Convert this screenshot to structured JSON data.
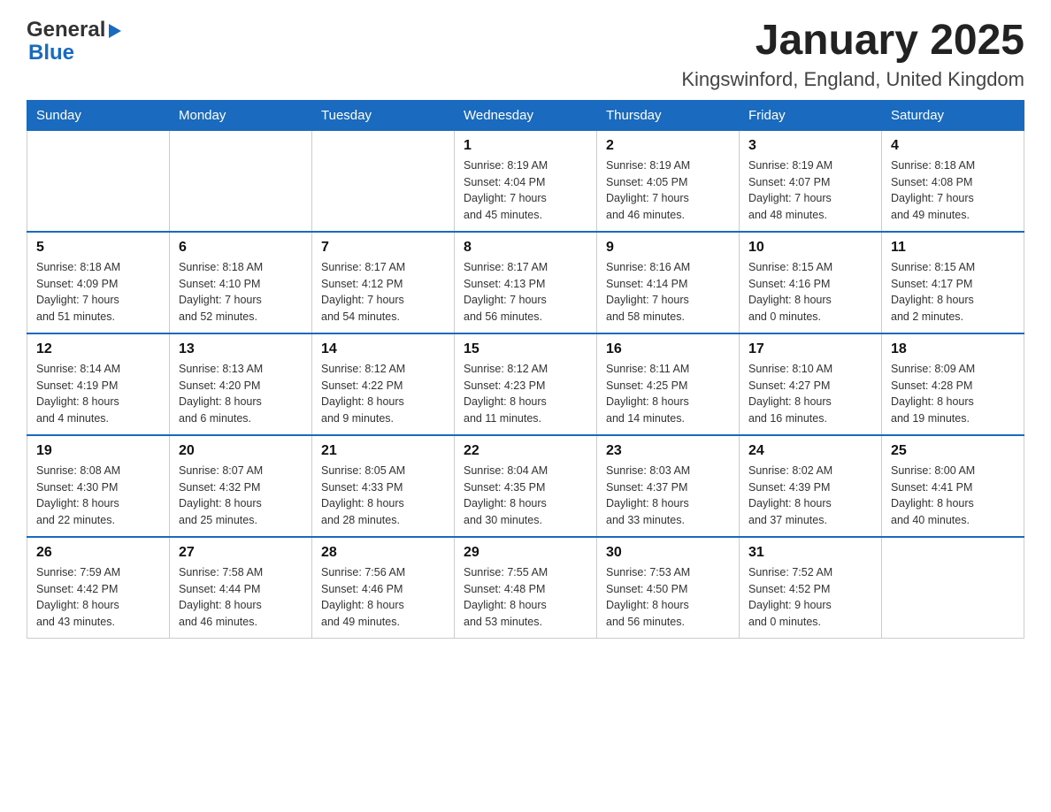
{
  "logo": {
    "general": "General",
    "blue": "Blue"
  },
  "header": {
    "month_year": "January 2025",
    "location": "Kingswinford, England, United Kingdom"
  },
  "weekdays": [
    "Sunday",
    "Monday",
    "Tuesday",
    "Wednesday",
    "Thursday",
    "Friday",
    "Saturday"
  ],
  "weeks": [
    [
      {
        "day": "",
        "info": ""
      },
      {
        "day": "",
        "info": ""
      },
      {
        "day": "",
        "info": ""
      },
      {
        "day": "1",
        "info": "Sunrise: 8:19 AM\nSunset: 4:04 PM\nDaylight: 7 hours\nand 45 minutes."
      },
      {
        "day": "2",
        "info": "Sunrise: 8:19 AM\nSunset: 4:05 PM\nDaylight: 7 hours\nand 46 minutes."
      },
      {
        "day": "3",
        "info": "Sunrise: 8:19 AM\nSunset: 4:07 PM\nDaylight: 7 hours\nand 48 minutes."
      },
      {
        "day": "4",
        "info": "Sunrise: 8:18 AM\nSunset: 4:08 PM\nDaylight: 7 hours\nand 49 minutes."
      }
    ],
    [
      {
        "day": "5",
        "info": "Sunrise: 8:18 AM\nSunset: 4:09 PM\nDaylight: 7 hours\nand 51 minutes."
      },
      {
        "day": "6",
        "info": "Sunrise: 8:18 AM\nSunset: 4:10 PM\nDaylight: 7 hours\nand 52 minutes."
      },
      {
        "day": "7",
        "info": "Sunrise: 8:17 AM\nSunset: 4:12 PM\nDaylight: 7 hours\nand 54 minutes."
      },
      {
        "day": "8",
        "info": "Sunrise: 8:17 AM\nSunset: 4:13 PM\nDaylight: 7 hours\nand 56 minutes."
      },
      {
        "day": "9",
        "info": "Sunrise: 8:16 AM\nSunset: 4:14 PM\nDaylight: 7 hours\nand 58 minutes."
      },
      {
        "day": "10",
        "info": "Sunrise: 8:15 AM\nSunset: 4:16 PM\nDaylight: 8 hours\nand 0 minutes."
      },
      {
        "day": "11",
        "info": "Sunrise: 8:15 AM\nSunset: 4:17 PM\nDaylight: 8 hours\nand 2 minutes."
      }
    ],
    [
      {
        "day": "12",
        "info": "Sunrise: 8:14 AM\nSunset: 4:19 PM\nDaylight: 8 hours\nand 4 minutes."
      },
      {
        "day": "13",
        "info": "Sunrise: 8:13 AM\nSunset: 4:20 PM\nDaylight: 8 hours\nand 6 minutes."
      },
      {
        "day": "14",
        "info": "Sunrise: 8:12 AM\nSunset: 4:22 PM\nDaylight: 8 hours\nand 9 minutes."
      },
      {
        "day": "15",
        "info": "Sunrise: 8:12 AM\nSunset: 4:23 PM\nDaylight: 8 hours\nand 11 minutes."
      },
      {
        "day": "16",
        "info": "Sunrise: 8:11 AM\nSunset: 4:25 PM\nDaylight: 8 hours\nand 14 minutes."
      },
      {
        "day": "17",
        "info": "Sunrise: 8:10 AM\nSunset: 4:27 PM\nDaylight: 8 hours\nand 16 minutes."
      },
      {
        "day": "18",
        "info": "Sunrise: 8:09 AM\nSunset: 4:28 PM\nDaylight: 8 hours\nand 19 minutes."
      }
    ],
    [
      {
        "day": "19",
        "info": "Sunrise: 8:08 AM\nSunset: 4:30 PM\nDaylight: 8 hours\nand 22 minutes."
      },
      {
        "day": "20",
        "info": "Sunrise: 8:07 AM\nSunset: 4:32 PM\nDaylight: 8 hours\nand 25 minutes."
      },
      {
        "day": "21",
        "info": "Sunrise: 8:05 AM\nSunset: 4:33 PM\nDaylight: 8 hours\nand 28 minutes."
      },
      {
        "day": "22",
        "info": "Sunrise: 8:04 AM\nSunset: 4:35 PM\nDaylight: 8 hours\nand 30 minutes."
      },
      {
        "day": "23",
        "info": "Sunrise: 8:03 AM\nSunset: 4:37 PM\nDaylight: 8 hours\nand 33 minutes."
      },
      {
        "day": "24",
        "info": "Sunrise: 8:02 AM\nSunset: 4:39 PM\nDaylight: 8 hours\nand 37 minutes."
      },
      {
        "day": "25",
        "info": "Sunrise: 8:00 AM\nSunset: 4:41 PM\nDaylight: 8 hours\nand 40 minutes."
      }
    ],
    [
      {
        "day": "26",
        "info": "Sunrise: 7:59 AM\nSunset: 4:42 PM\nDaylight: 8 hours\nand 43 minutes."
      },
      {
        "day": "27",
        "info": "Sunrise: 7:58 AM\nSunset: 4:44 PM\nDaylight: 8 hours\nand 46 minutes."
      },
      {
        "day": "28",
        "info": "Sunrise: 7:56 AM\nSunset: 4:46 PM\nDaylight: 8 hours\nand 49 minutes."
      },
      {
        "day": "29",
        "info": "Sunrise: 7:55 AM\nSunset: 4:48 PM\nDaylight: 8 hours\nand 53 minutes."
      },
      {
        "day": "30",
        "info": "Sunrise: 7:53 AM\nSunset: 4:50 PM\nDaylight: 8 hours\nand 56 minutes."
      },
      {
        "day": "31",
        "info": "Sunrise: 7:52 AM\nSunset: 4:52 PM\nDaylight: 9 hours\nand 0 minutes."
      },
      {
        "day": "",
        "info": ""
      }
    ]
  ]
}
